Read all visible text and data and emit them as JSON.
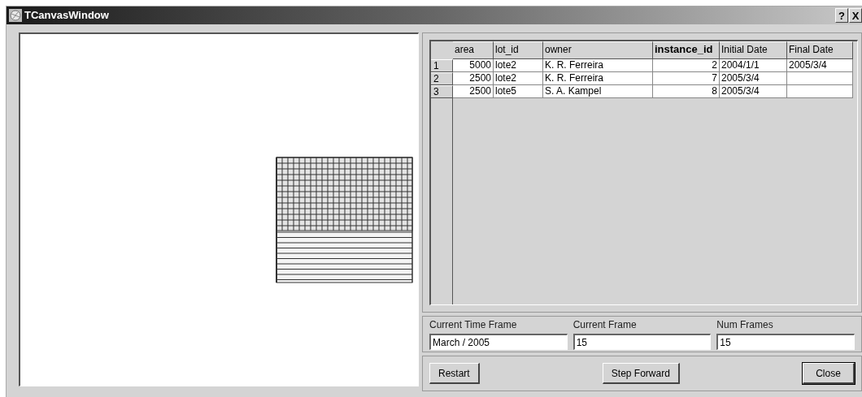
{
  "window": {
    "title": "TCanvasWindow",
    "title_buttons": [
      "?",
      "X"
    ]
  },
  "table": {
    "columns": [
      {
        "label": "area",
        "selected": false
      },
      {
        "label": "lot_id",
        "selected": false
      },
      {
        "label": "owner",
        "selected": false
      },
      {
        "label": "instance_id",
        "selected": true
      },
      {
        "label": "Initial Date",
        "selected": false
      },
      {
        "label": "Final Date",
        "selected": false
      }
    ],
    "rows": [
      {
        "number": "1",
        "cells": [
          "5000",
          "lote2",
          "K. R. Ferreira",
          "2",
          "2004/1/1",
          "2005/3/4"
        ]
      },
      {
        "number": "2",
        "cells": [
          "2500",
          "lote2",
          "K. R. Ferreira",
          "7",
          "2005/3/4",
          ""
        ]
      },
      {
        "number": "3",
        "cells": [
          "2500",
          "lote5",
          "S. A. Kampel",
          "8",
          "2005/3/4",
          ""
        ]
      }
    ]
  },
  "fields": [
    {
      "label": "Current Time Frame",
      "value": "March / 2005"
    },
    {
      "label": "Current Frame",
      "value": "15"
    },
    {
      "label": "Num Frames",
      "value": "15"
    }
  ],
  "buttons": [
    {
      "label": "Restart",
      "default": false
    },
    {
      "label": "Step Forward",
      "default": false
    },
    {
      "label": "Close",
      "default": true
    }
  ]
}
